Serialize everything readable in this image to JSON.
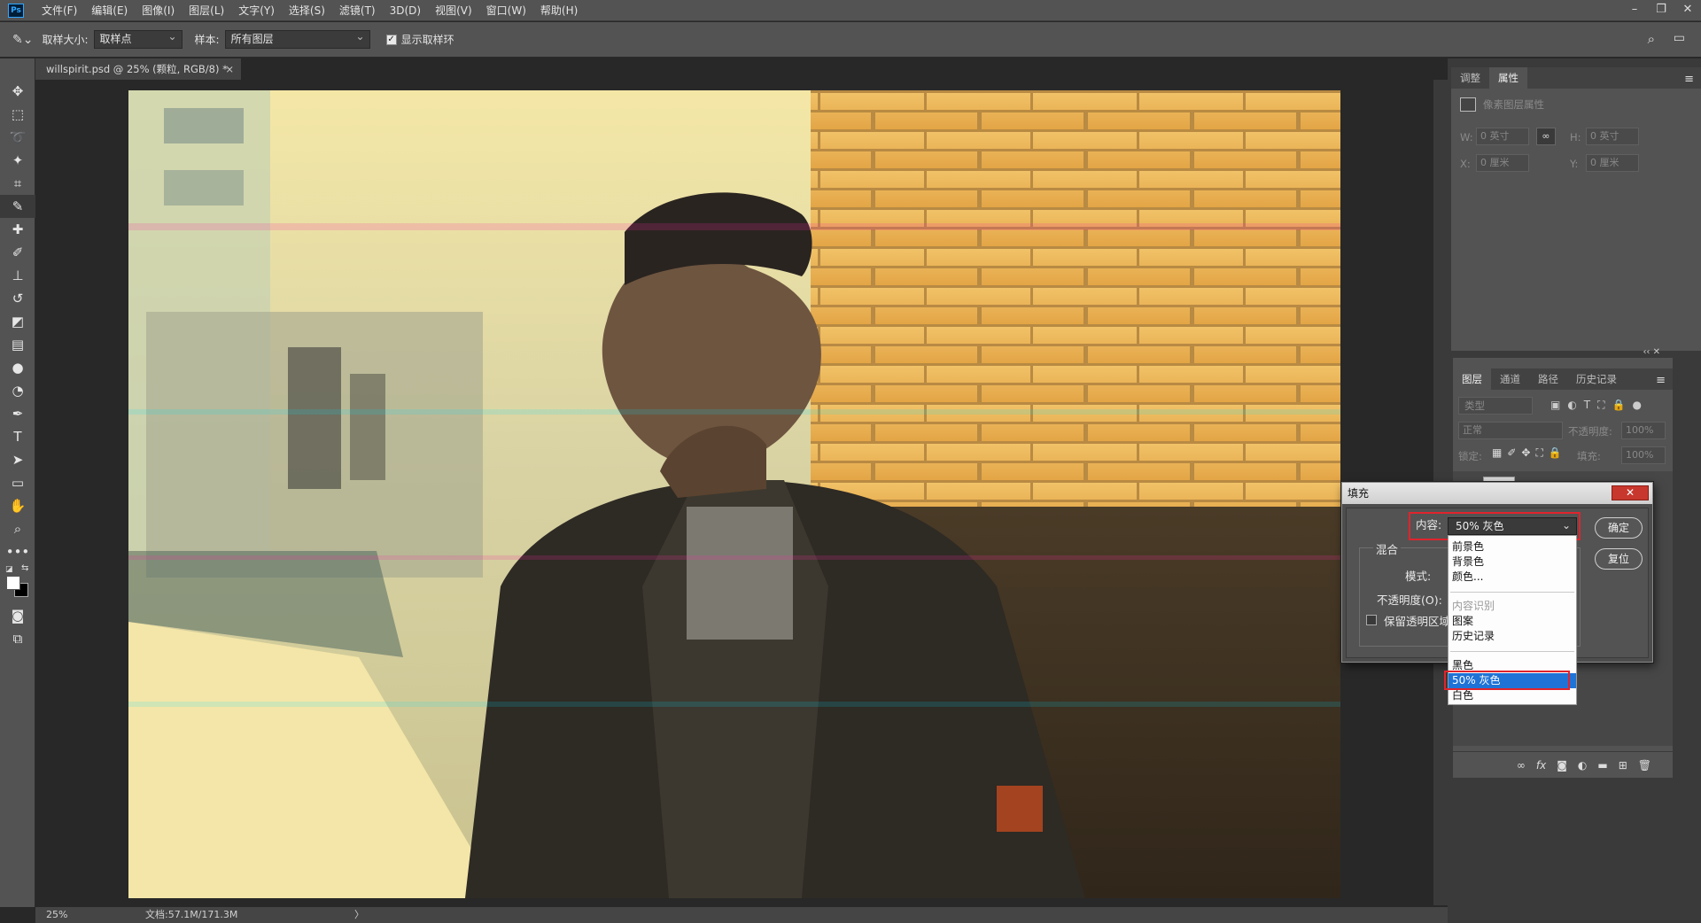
{
  "app": {
    "logo": "Ps"
  },
  "menu": [
    "文件(F)",
    "编辑(E)",
    "图像(I)",
    "图层(L)",
    "文字(Y)",
    "选择(S)",
    "滤镜(T)",
    "3D(D)",
    "视图(V)",
    "窗口(W)",
    "帮助(H)"
  ],
  "window_controls": {
    "minimize": "–",
    "restore": "❐",
    "close": "✕"
  },
  "options": {
    "sample_size_label": "取样大小:",
    "sample_size_value": "取样点",
    "sample_label": "样本:",
    "sample_value": "所有图层",
    "show_ring_label": "显示取样环",
    "show_ring_checked": true
  },
  "document": {
    "tab_title": "willspirit.psd @ 25% (颗粒, RGB/8) *",
    "zoom": "25%",
    "doc_info": "文档:57.1M/171.3M",
    "arrow": "〉"
  },
  "properties_panel": {
    "tabs": [
      "调整",
      "属性"
    ],
    "active_tab": "属性",
    "header": "像素图层属性",
    "w_label": "W:",
    "w_value": "0 英寸",
    "h_label": "H:",
    "h_value": "0 英寸",
    "x_label": "X:",
    "x_value": "0 厘米",
    "y_label": "Y:",
    "y_value": "0 厘米"
  },
  "layers_panel": {
    "tabs": [
      "图层",
      "通道",
      "路径",
      "历史记录"
    ],
    "active_tab": "图层",
    "filter_placeholder": "类型",
    "blend_mode": "正常",
    "opacity_label": "不透明度:",
    "opacity_value": "100%",
    "lock_label": "锁定:",
    "fill_label": "填充:",
    "fill_value": "100%",
    "footer_fx": "fx"
  },
  "fill_dialog": {
    "title": "填充",
    "content_label": "内容:",
    "content_value": "50% 灰色",
    "blend_group_label": "混合",
    "mode_label": "模式:",
    "opacity_label": "不透明度(O):",
    "preserve_label": "保留透明区域",
    "ok_label": "确定",
    "reset_label": "复位",
    "close_label": "✕"
  },
  "content_dropdown": {
    "options": [
      "前景色",
      "背景色",
      "颜色...",
      "内容识别",
      "图案",
      "历史记录",
      "黑色",
      "50% 灰色",
      "白色"
    ],
    "selected": "50% 灰色",
    "disabled": [
      "内容识别"
    ]
  },
  "colors": {
    "accent_red": "#e0242c",
    "selection_blue": "#1f73d6",
    "ps_blue": "#31a8ff"
  }
}
